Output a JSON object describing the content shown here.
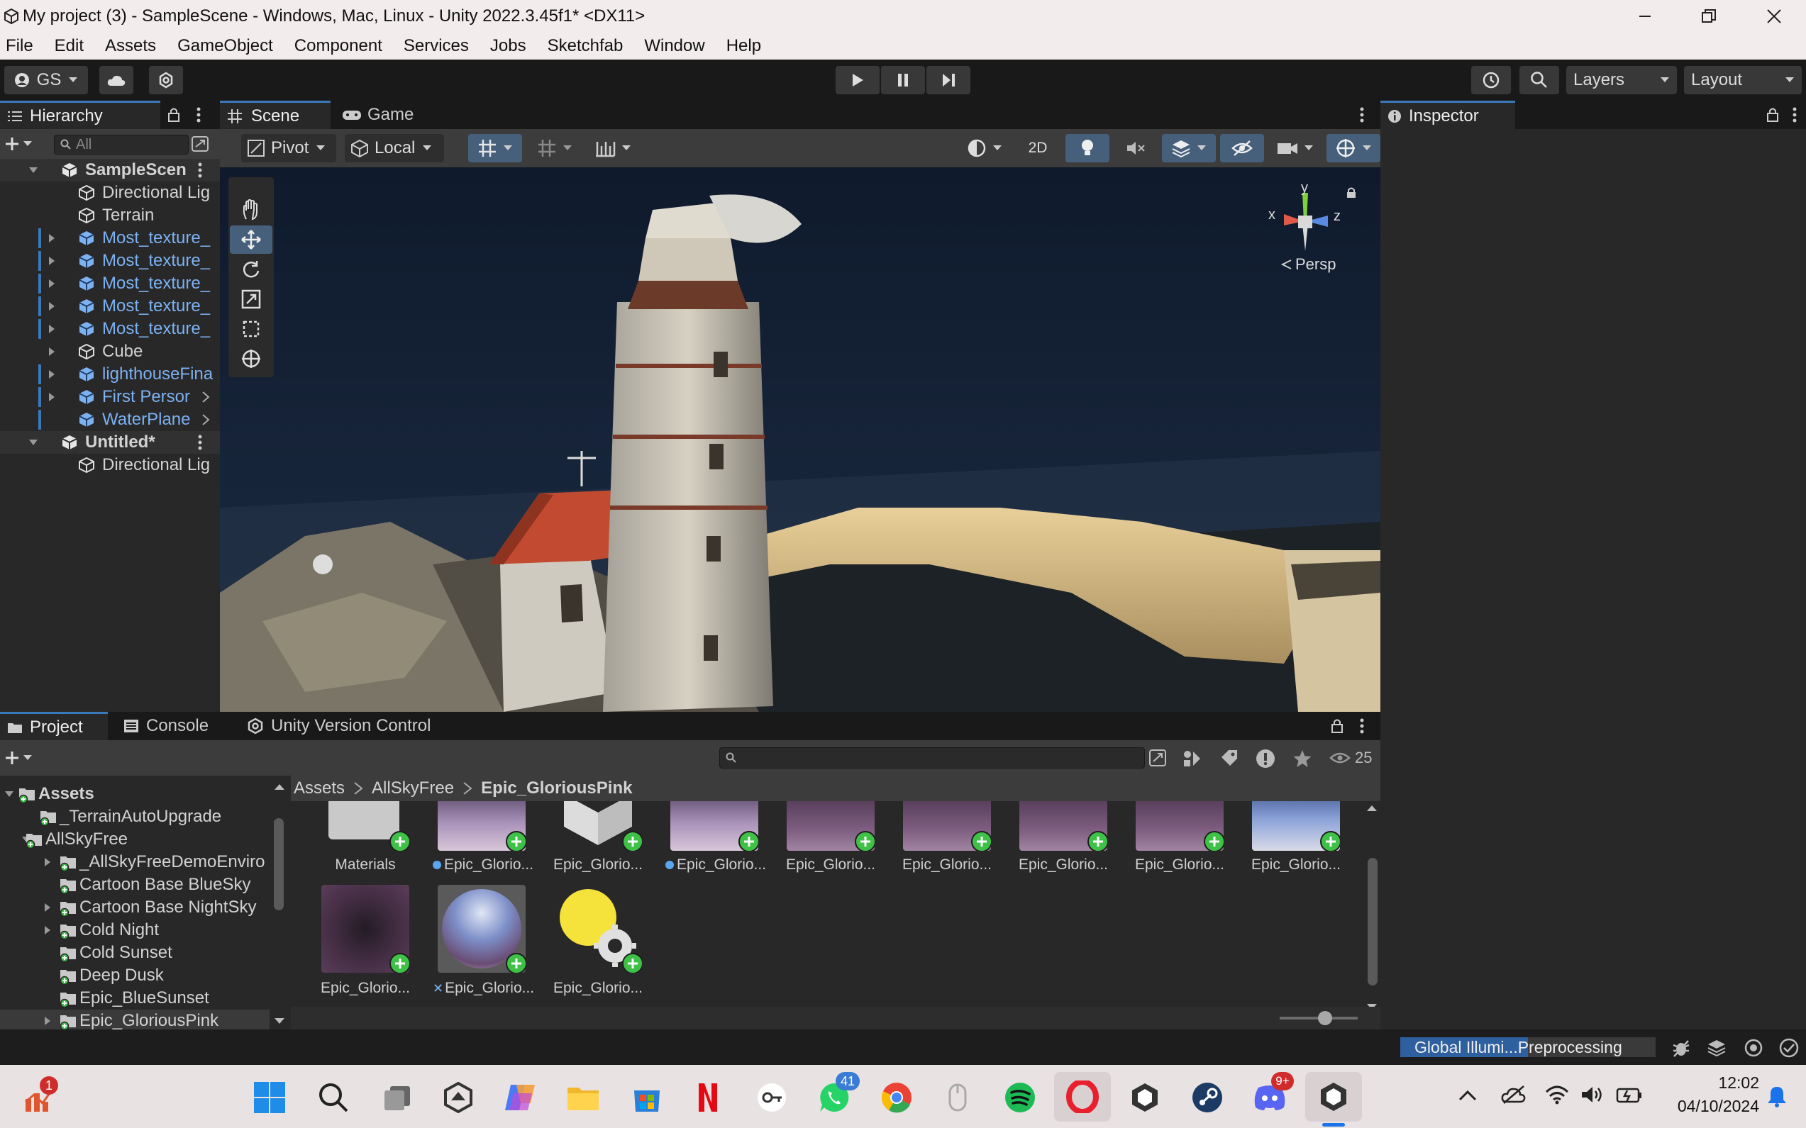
{
  "window": {
    "title": "My project (3) - SampleScene - Windows, Mac, Linux - Unity 2022.3.45f1* <DX11>"
  },
  "menu": [
    "File",
    "Edit",
    "Assets",
    "GameObject",
    "Component",
    "Services",
    "Jobs",
    "Sketchfab",
    "Window",
    "Help"
  ],
  "toolbar": {
    "account": "GS",
    "layers": "Layers",
    "layout": "Layout"
  },
  "hierarchy": {
    "tab": "Hierarchy",
    "search_placeholder": "All",
    "items": [
      {
        "label": "SampleScen",
        "style": "scene"
      },
      {
        "label": "Directional Lig",
        "style": "plain"
      },
      {
        "label": "Terrain",
        "style": "plain"
      },
      {
        "label": "Most_texture_",
        "style": "prefab"
      },
      {
        "label": "Most_texture_",
        "style": "prefab"
      },
      {
        "label": "Most_texture_",
        "style": "prefab"
      },
      {
        "label": "Most_texture_",
        "style": "prefab"
      },
      {
        "label": "Most_texture_",
        "style": "prefab"
      },
      {
        "label": "Cube",
        "style": "plain"
      },
      {
        "label": "lighthouseFina",
        "style": "prefab"
      },
      {
        "label": "First Persor",
        "style": "prefab"
      },
      {
        "label": "WaterPlane",
        "style": "prefab"
      },
      {
        "label": "Untitled*",
        "style": "scene"
      },
      {
        "label": "Directional Lig",
        "style": "plain"
      }
    ]
  },
  "scene_view": {
    "tabs": [
      "Scene",
      "Game"
    ],
    "pivot": "Pivot",
    "local": "Local",
    "mode_2d": "2D",
    "gizmo": {
      "x": "x",
      "y": "y",
      "z": "z",
      "projection": "Persp"
    }
  },
  "inspector": {
    "tab": "Inspector"
  },
  "bottom": {
    "tabs": [
      "Project",
      "Console",
      "Unity Version Control"
    ],
    "hidden_count": "25",
    "breadcrumb": [
      "Assets",
      "AllSkyFree",
      "Epic_GloriousPink"
    ],
    "tree": [
      {
        "label": "Assets",
        "level": 0
      },
      {
        "label": "_TerrainAutoUpgrade",
        "level": 1
      },
      {
        "label": "AllSkyFree",
        "level": 1
      },
      {
        "label": "_AllSkyFreeDemoEnviro",
        "level": 2
      },
      {
        "label": "Cartoon Base BlueSky",
        "level": 2
      },
      {
        "label": "Cartoon Base NightSky",
        "level": 2
      },
      {
        "label": "Cold Night",
        "level": 2
      },
      {
        "label": "Cold Sunset",
        "level": 2
      },
      {
        "label": "Deep Dusk",
        "level": 2
      },
      {
        "label": "Epic_BlueSunset",
        "level": 2
      },
      {
        "label": "Epic_GloriousPink",
        "level": 2
      }
    ],
    "assets_row1": [
      "Materials",
      "Epic_Glorio...",
      "Epic_Glorio...",
      "Epic_Glorio...",
      "Epic_Glorio...",
      "Epic_Glorio...",
      "Epic_Glorio...",
      "Epic_Glorio...",
      "Epic_Glorio..."
    ],
    "assets_row2": [
      "Epic_Glorio...",
      "Epic_Glorio...",
      "Epic_Glorio..."
    ]
  },
  "status": {
    "progress_label": "Global Illumi...Preprocessing"
  },
  "taskbar": {
    "time": "12:02",
    "date": "04/10/2024",
    "whatsapp_badge": "41",
    "discord_badge": "9+",
    "widget_badge": "1"
  },
  "colors": {
    "accent": "#3a79bb",
    "prefab_blue": "#7cb1f2",
    "add_green": "#3fc047",
    "panel": "#282828"
  }
}
